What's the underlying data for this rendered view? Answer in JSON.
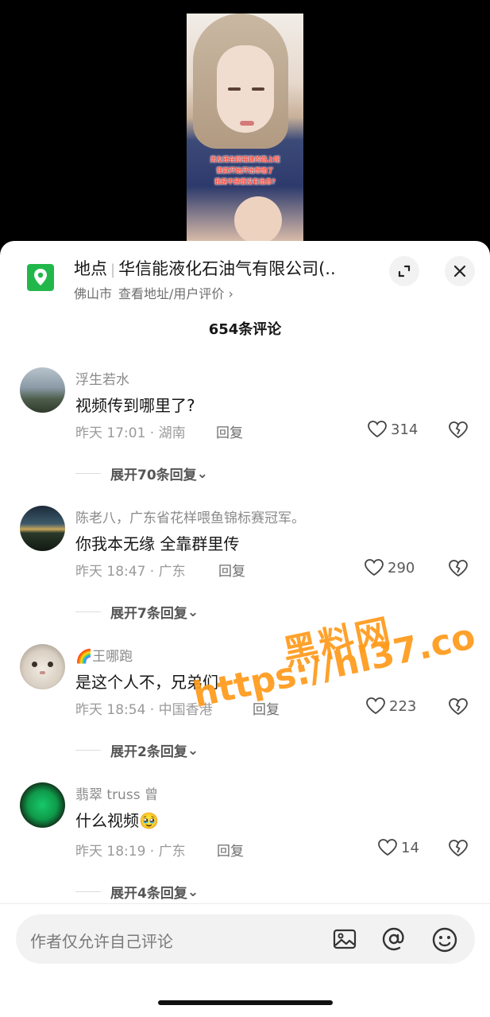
{
  "video": {
    "caption_lines": [
      "男友还在回福建的路上呢",
      "我就开始开始想他了",
      "我是不是很没有出息?"
    ]
  },
  "place": {
    "label": "地点",
    "name": "华信能液化石油气有限公司(..",
    "city": "佛山市",
    "link": "查看地址/用户评价",
    "icon": "location-pin-icon",
    "icon_color": "#22b74b"
  },
  "comments_header": {
    "count_text": "654条评论"
  },
  "comments": [
    {
      "name": "浮生若水",
      "text": "视频传到哪里了?",
      "time": "昨天 17:01",
      "location": "湖南",
      "reply": "回复",
      "likes": "314",
      "expand": "展开70条回复"
    },
    {
      "name": "陈老八，广东省花样喂鱼锦标赛冠军。",
      "text": "你我本无缘 全靠群里传",
      "time": "昨天 18:47",
      "location": "广东",
      "reply": "回复",
      "likes": "290",
      "expand": "展开7条回复"
    },
    {
      "name": "王哪跑",
      "name_prefix": "🌈",
      "text": "是这个人不，兄弟们",
      "time": "昨天 18:54",
      "location": "中国香港",
      "reply": "回复",
      "likes": "223",
      "expand": "展开2条回复"
    },
    {
      "name": "翡翠 truss 曾",
      "text": "什么视频",
      "text_emoji": "🥹",
      "time": "昨天 18:19",
      "location": "广东",
      "reply": "回复",
      "likes": "14",
      "expand": "展开4条回复"
    }
  ],
  "watermark": {
    "line1": "黑料网",
    "line2": "https://hl37.co"
  },
  "input": {
    "placeholder": "作者仅允许自己评论",
    "icons": [
      "image-icon",
      "at-icon",
      "emoji-icon"
    ]
  }
}
